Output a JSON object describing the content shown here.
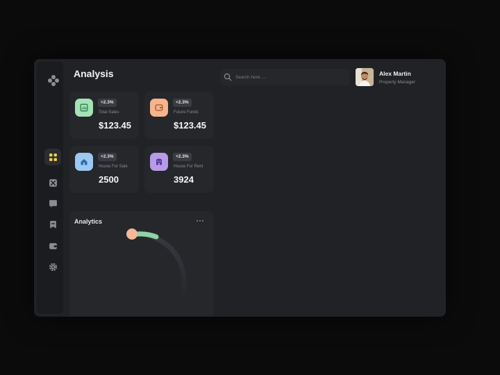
{
  "page": {
    "title": "Analysis"
  },
  "sidebar": {
    "items": [
      {
        "icon": "grid-icon",
        "active": true
      },
      {
        "icon": "chart-icon",
        "active": false
      },
      {
        "icon": "message-icon",
        "active": false
      },
      {
        "icon": "bookmark-icon",
        "active": false
      },
      {
        "icon": "wallet-icon",
        "active": false
      },
      {
        "icon": "gear-icon",
        "active": false
      }
    ]
  },
  "cards": [
    {
      "label": "Total Sales",
      "value": "$123.45",
      "badge": "+2.3%",
      "icon": "chart-icon",
      "color": "#a3e3b5"
    },
    {
      "label": "Future Funds",
      "value": "$123.45",
      "badge": "+2.3%",
      "icon": "wallet-icon",
      "color": "#f6b48d"
    },
    {
      "label": "House For Sale",
      "value": "2500",
      "badge": "+2.3%",
      "icon": "home-icon",
      "color": "#9dc8f2"
    },
    {
      "label": "House For Rent",
      "value": "3924",
      "badge": "+2.3%",
      "icon": "building-icon",
      "color": "#b79ae8"
    }
  ],
  "analytics": {
    "title": "Analytics"
  },
  "search": {
    "placeholder": "Search here....."
  },
  "user": {
    "name": "Alex Martin",
    "role": "Property Manager"
  },
  "colors": {
    "background": "#0b0b0c",
    "window": "#202225",
    "card": "#25272b",
    "accent_green": "#8fd3a5",
    "accent_peach": "#f3b79a"
  }
}
